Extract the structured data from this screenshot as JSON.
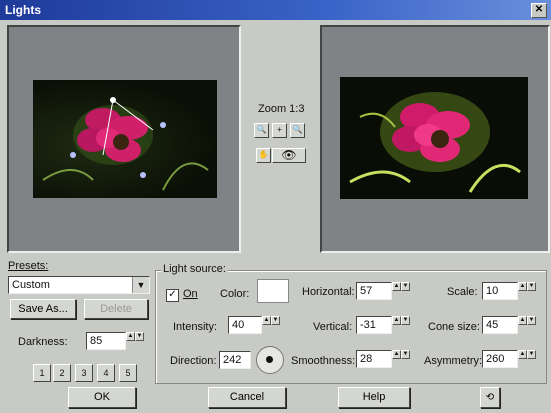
{
  "window": {
    "title": "Lights"
  },
  "zoom": {
    "label": "Zoom 1:3"
  },
  "presets": {
    "label": "Presets:",
    "selected": "Custom",
    "save_as": "Save As...",
    "delete": "Delete"
  },
  "darkness": {
    "label": "Darkness:",
    "value": "85"
  },
  "light_source": {
    "legend": "Light source:",
    "on_label": "On",
    "on_checked": true,
    "color_label": "Color:",
    "intensity_label": "Intensity:",
    "intensity_value": "40",
    "direction_label": "Direction:",
    "direction_value": "242",
    "horizontal_label": "Horizontal:",
    "horizontal_value": "57",
    "vertical_label": "Vertical:",
    "vertical_value": "-31",
    "smoothness_label": "Smoothness:",
    "smoothness_value": "28",
    "scale_label": "Scale:",
    "scale_value": "10",
    "cone_label": "Cone size:",
    "cone_value": "45",
    "asymmetry_label": "Asymmetry:",
    "asymmetry_value": "260"
  },
  "light_buttons": [
    "1",
    "2",
    "3",
    "4",
    "5"
  ],
  "footer": {
    "ok": "OK",
    "cancel": "Cancel",
    "help": "Help"
  },
  "colors": {
    "titlebar": "#1e3a9a",
    "window": "#c8cac5",
    "flower": "#d01a6a"
  }
}
